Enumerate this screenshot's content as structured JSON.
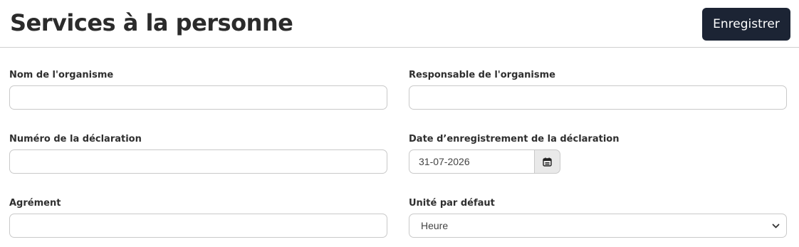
{
  "header": {
    "title": "Services à la personne",
    "save_label": "Enregistrer"
  },
  "form": {
    "nom_organisme": {
      "label": "Nom de l'organisme",
      "value": ""
    },
    "responsable_organisme": {
      "label": "Responsable de l'organisme",
      "value": ""
    },
    "numero_declaration": {
      "label": "Numéro de la déclaration",
      "value": ""
    },
    "date_enregistrement": {
      "label": "Date d’enregistrement de la déclaration",
      "value": "31-07-2026",
      "icon": "calendar-icon"
    },
    "agrement": {
      "label": "Agrément",
      "value": ""
    },
    "unite_defaut": {
      "label": "Unité par défaut",
      "value": "Heure",
      "icon": "chevron-down-icon"
    }
  },
  "colors": {
    "primary_button": "#1c2434",
    "border": "#c9c9c9",
    "addon_bg": "#e9e9e9"
  }
}
